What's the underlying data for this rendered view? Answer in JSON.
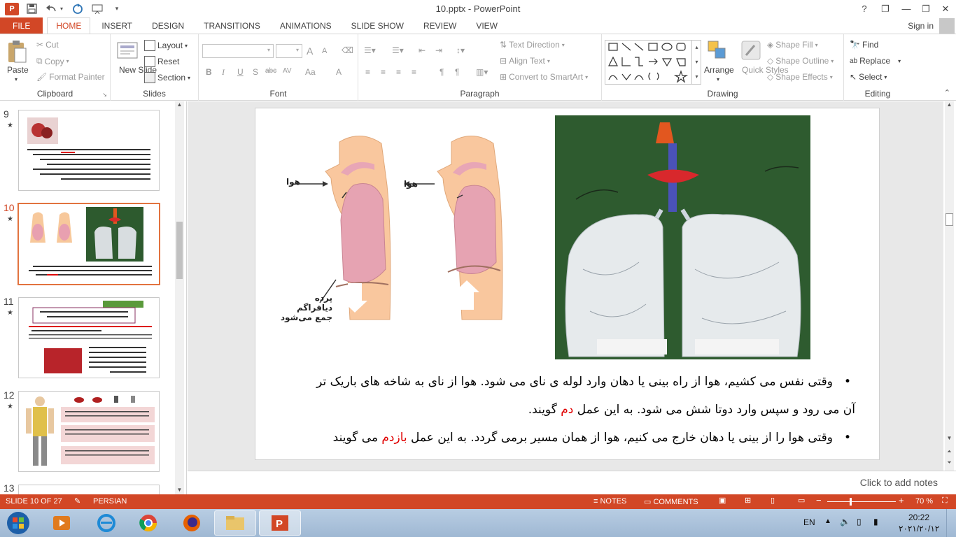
{
  "window": {
    "title": "10.pptx - PowerPoint"
  },
  "tabs": [
    "FILE",
    "HOME",
    "INSERT",
    "DESIGN",
    "TRANSITIONS",
    "ANIMATIONS",
    "SLIDE SHOW",
    "REVIEW",
    "VIEW"
  ],
  "active_tab": "HOME",
  "signin": "Sign in",
  "window_controls": [
    "?",
    "❐",
    "—",
    "❐",
    "✕"
  ],
  "ribbon": {
    "clipboard": {
      "label": "Clipboard",
      "paste": "Paste",
      "cut": "Cut",
      "copy": "Copy",
      "format_painter": "Format Painter"
    },
    "slides": {
      "label": "Slides",
      "new_slide": "New Slide",
      "layout": "Layout",
      "reset": "Reset",
      "section": "Section"
    },
    "font": {
      "label": "Font",
      "buttons": [
        "B",
        "I",
        "U",
        "S",
        "abc",
        "AV",
        "Aa",
        "A"
      ],
      "grow": "A",
      "shrink": "A"
    },
    "paragraph": {
      "label": "Paragraph",
      "text_direction": "Text Direction",
      "align_text": "Align Text",
      "convert_smartart": "Convert to SmartArt"
    },
    "drawing": {
      "label": "Drawing",
      "arrange": "Arrange",
      "quick_styles": "Quick Styles",
      "shape_fill": "Shape Fill",
      "shape_outline": "Shape Outline",
      "shape_effects": "Shape Effects"
    },
    "editing": {
      "label": "Editing",
      "find": "Find",
      "replace": "Replace",
      "select": "Select"
    }
  },
  "thumbnails": [
    {
      "num": "9",
      "star": "★",
      "selected": false
    },
    {
      "num": "10",
      "star": "★",
      "selected": true
    },
    {
      "num": "11",
      "star": "★",
      "selected": false
    },
    {
      "num": "12",
      "star": "★",
      "selected": false
    },
    {
      "num": "13",
      "star": "",
      "selected": false
    }
  ],
  "slide": {
    "diagram": {
      "air_left": "هوا",
      "air_right": "هوا",
      "diaphragm_line1": "پرده دیافراگم",
      "diaphragm_line2": "جمع می‌شود"
    },
    "bullet1_part1": "وقتی نفس می کشیم، هوا از راه بینی یا دهان وارد لوله ی نای می شود. هوا از نای به شاخه های باریک تر",
    "bullet1_part2": "آن می رود و سپس وارد دوتا شش می شود. به این عمل",
    "bullet1_red": "دم",
    "bullet1_end": "گویند.",
    "bullet2_part1": "وقتی هوا را از بینی یا دهان خارج می کنیم، هوا از همان مسیر برمی گردد. به این عمل",
    "bullet2_red": "بازدم",
    "bullet2_end": "می گویند",
    "bullet_symbol": "•"
  },
  "notes_placeholder": "Click to add notes",
  "status": {
    "slide_info": "SLIDE 10 OF 27",
    "language": "PERSIAN",
    "notes": "NOTES",
    "comments": "COMMENTS",
    "zoom": "70 %"
  },
  "zoom_percent": 70,
  "taskbar": {
    "language": "EN",
    "time": "20:22",
    "date": "۲۰۲۱/۲۰/۱۲"
  },
  "colors": {
    "accent": "#d24726",
    "red_text": "#e00000"
  }
}
